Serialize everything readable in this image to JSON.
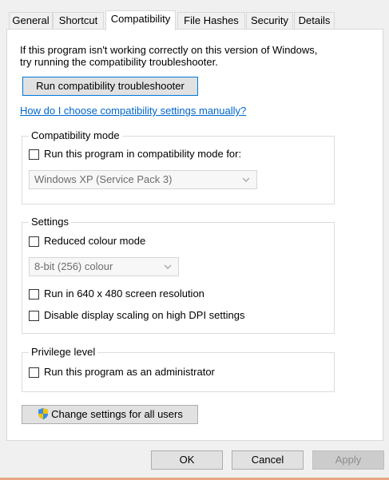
{
  "tabs": [
    {
      "label": "General"
    },
    {
      "label": "Shortcut"
    },
    {
      "label": "Compatibility"
    },
    {
      "label": "File Hashes"
    },
    {
      "label": "Security"
    },
    {
      "label": "Details"
    }
  ],
  "active_tab": "Compatibility",
  "intro": {
    "line1": "If this program isn't working correctly on this version of Windows,",
    "line2": "try running the compatibility troubleshooter."
  },
  "troubleshooter_button": "Run compatibility troubleshooter",
  "help_link": "How do I choose compatibility settings manually?",
  "compatibility_mode": {
    "title": "Compatibility mode",
    "checkbox_label": "Run this program in compatibility mode for:",
    "checked": false,
    "select_value": "Windows XP (Service Pack 3)"
  },
  "settings": {
    "title": "Settings",
    "reduced_colour_label": "Reduced colour mode",
    "reduced_colour_checked": false,
    "colour_select_value": "8-bit (256) colour",
    "resolution_label": "Run in 640 x 480 screen resolution",
    "resolution_checked": false,
    "dpi_label": "Disable display scaling on high DPI settings",
    "dpi_checked": false
  },
  "privilege": {
    "title": "Privilege level",
    "admin_label": "Run this program as an administrator",
    "admin_checked": false
  },
  "change_all_button": "Change settings for all users",
  "dialog_buttons": {
    "ok": "OK",
    "cancel": "Cancel",
    "apply": "Apply"
  },
  "colors": {
    "link": "#0066cc",
    "focus_border": "#0078d7",
    "window_frame": "#e8a583"
  }
}
